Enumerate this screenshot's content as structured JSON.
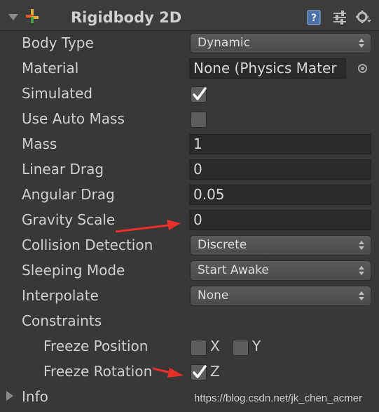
{
  "component": {
    "title": "Rigidbody 2D",
    "icons": [
      "foldout-arrow-icon",
      "rigidbody-component-icon",
      "help-book-icon",
      "preset-sliders-icon",
      "gear-icon"
    ]
  },
  "fields": {
    "body_type": {
      "label": "Body Type",
      "value": "Dynamic"
    },
    "material": {
      "label": "Material",
      "value": "None (Physics Mater"
    },
    "simulated": {
      "label": "Simulated",
      "checked": true
    },
    "use_auto_mass": {
      "label": "Use Auto Mass",
      "checked": false
    },
    "mass": {
      "label": "Mass",
      "value": "1"
    },
    "linear_drag": {
      "label": "Linear Drag",
      "value": "0"
    },
    "angular_drag": {
      "label": "Angular Drag",
      "value": "0.05"
    },
    "gravity_scale": {
      "label": "Gravity Scale",
      "value": "0"
    },
    "collision_detection": {
      "label": "Collision Detection",
      "value": "Discrete"
    },
    "sleeping_mode": {
      "label": "Sleeping Mode",
      "value": "Start Awake"
    },
    "interpolate": {
      "label": "Interpolate",
      "value": "None"
    }
  },
  "constraints": {
    "label": "Constraints",
    "freeze_position": {
      "label": "Freeze Position",
      "x_label": "X",
      "y_label": "Y",
      "x": false,
      "y": false
    },
    "freeze_rotation": {
      "label": "Freeze Rotation",
      "z_label": "Z",
      "z": true
    }
  },
  "info": {
    "label": "Info"
  },
  "watermark": "https://blog.csdn.net/jk_chen_acmer",
  "colors": {
    "background": "#383838",
    "field_bg": "#2a2a2a",
    "annotation_arrow": "#e8302a"
  }
}
